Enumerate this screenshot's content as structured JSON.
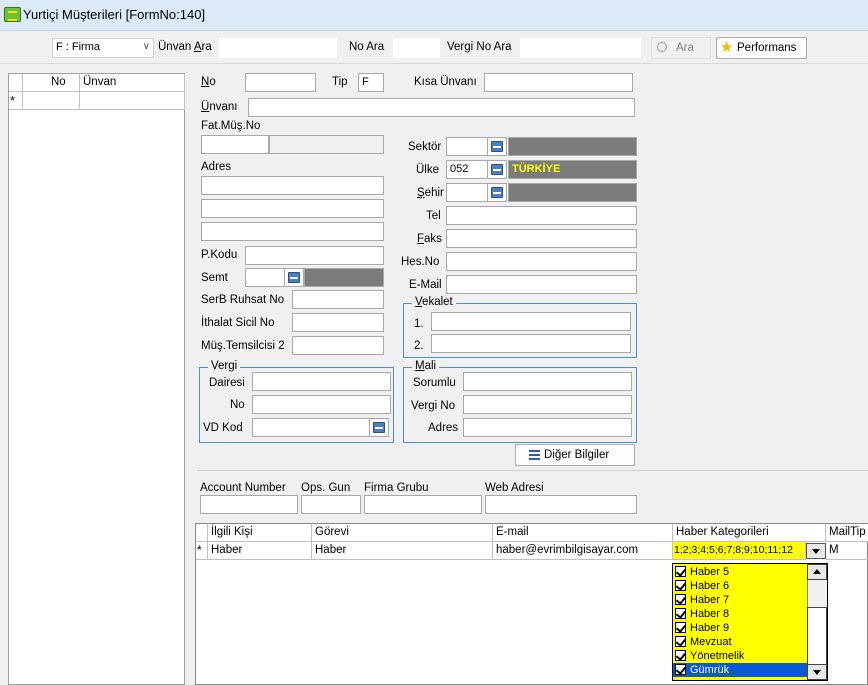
{
  "window": {
    "title": "Yurtiçi Müşterileri [FormNo:140]"
  },
  "search": {
    "type_value": "F : Firma",
    "unvan_label_pre": "Ünvan ",
    "unvan_label_acc": "A",
    "unvan_label_post": "ra",
    "no_label": "No Ara",
    "vergi_label": "Vergi No Ara",
    "ara_label": "Ara",
    "performans_label": "Performans"
  },
  "left_grid": {
    "col_no": "No",
    "col_unvan": "Ünvan",
    "new_marker": "*"
  },
  "form": {
    "no_label": "N",
    "no_label_rest": "o",
    "tip_label": "Tip",
    "tip_value": "F",
    "kisa_unvan_label": "Kısa Ünvanı",
    "unvani_label": "Ü",
    "unvani_label_rest": "nvanı",
    "fat_mus_no_label": "Fat.Müş.No",
    "adres_label": "Adres",
    "pkodu_label": "P.Kodu",
    "semt_label": "Semt",
    "serb_label": "SerB Ruhsat No",
    "ithalat_label": "İthalat Sicil No",
    "temsilci_label": "Müş.Temsilcisi 2",
    "sektor_label": "Sektör",
    "ulke_label": "Ülke",
    "ulke_code": "052",
    "ulke_name": "TÜRKİYE",
    "sehir_label": "Ş",
    "sehir_label_rest": "ehir",
    "tel_label": "Tel",
    "faks_label": "F",
    "faks_label_rest": "aks",
    "hesno_label": "Hes.No",
    "email_label": "E-Mail",
    "vekalet_label": "V",
    "vekalet_label_rest": "ekalet",
    "vekalet_1": "1.",
    "vekalet_2": "2.",
    "vergi_group": "Vergi",
    "vergi_dairesi": "Dairesi",
    "vergi_no": "No",
    "vd_kod": "VD Kod",
    "mali_group": "M",
    "mali_group_rest": "ali",
    "mali_sorumlu": "Sorumlu",
    "mali_vergi_no": "Vergi No",
    "mali_adres": "Adres",
    "diger_button": "Diğer Bilgiler",
    "account_number": "Account Number",
    "ops_gun": "Ops. Gun",
    "firma_grubu": "Firma Grubu",
    "web_adresi": "Web Adresi"
  },
  "contacts": {
    "headers": [
      "İlgili Kişi",
      "Görevi",
      "E-mail",
      "Haber Kategorileri",
      "MailTip"
    ],
    "new_marker": "*",
    "row": {
      "ilgili": "Haber",
      "gorevi": "Haber",
      "email": "haber@evrimbilgisayar.com",
      "kategoriler": "1;2;3;4;5;6;7;8;9;10;11;12",
      "mailtip": "M"
    },
    "dropdown_options": [
      "Haber 5",
      "Haber 6",
      "Haber 7",
      "Haber 8",
      "Haber 9",
      "Mevzuat",
      "Yönetmelik",
      "Gümrük"
    ]
  }
}
